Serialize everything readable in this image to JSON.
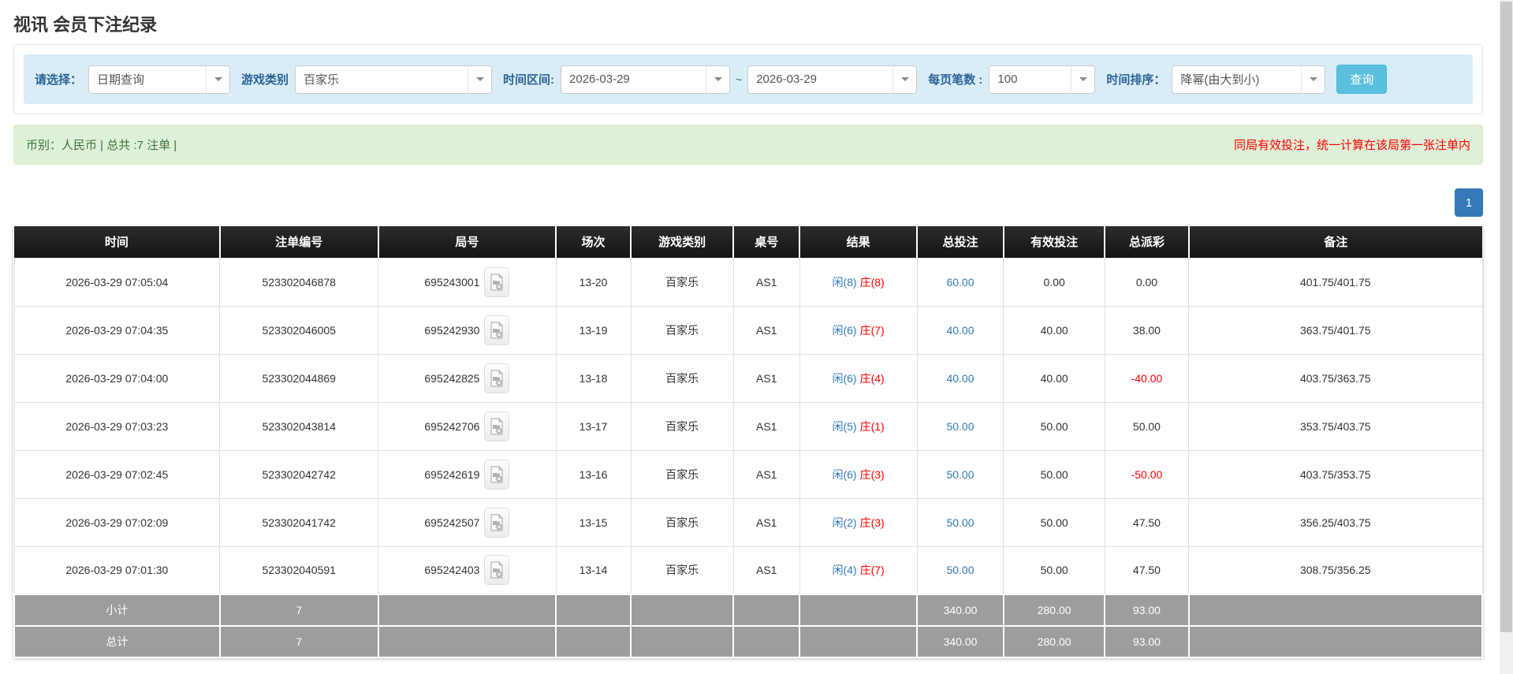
{
  "page": {
    "title": "视讯 会员下注纪录"
  },
  "colors": {
    "accent_blue": "#337ab7",
    "filter_bg": "#d9edf7",
    "summary_bg": "#dff0d8",
    "summary_text": "#3c763d",
    "alert_red": "#ff0000",
    "header_bg": "#1c1c1c",
    "total_row_bg": "#9d9d9d",
    "query_btn": "#5bc0de"
  },
  "filters": {
    "select_label": "请选择：",
    "select_value": "日期查询",
    "game_label": "游戏类别",
    "game_value": "百家乐",
    "range_label": "时间区间:",
    "date_from": "2026-03-29",
    "tilde": "~",
    "date_to": "2026-03-29",
    "per_page_label": "每页笔数 :",
    "per_page_value": "100",
    "sort_label": "时间排序：",
    "sort_value": "降幂(由大到小)",
    "query_button": "查询"
  },
  "summary": {
    "info": "币别：人民币 | 总共 :7 注单 |",
    "note": "同局有效投注，统一计算在该局第一张注单内"
  },
  "pagination": {
    "current": "1"
  },
  "table": {
    "headers": [
      "时间",
      "注单编号",
      "局号",
      "场次",
      "游戏类别",
      "桌号",
      "结果",
      "总投注",
      "有效投注",
      "总派彩",
      "备注"
    ],
    "rows": [
      {
        "time": "2026-03-29 07:05:04",
        "bet_id": "523302046878",
        "round_id": "695243001",
        "session": "13-20",
        "game": "百家乐",
        "table": "AS1",
        "player": "闲(8)",
        "banker": "庄(8)",
        "total_bet": "60.00",
        "valid_bet": "0.00",
        "payout": "0.00",
        "payout_neg": false,
        "note": "401.75/401.75"
      },
      {
        "time": "2026-03-29 07:04:35",
        "bet_id": "523302046005",
        "round_id": "695242930",
        "session": "13-19",
        "game": "百家乐",
        "table": "AS1",
        "player": "闲(6)",
        "banker": "庄(7)",
        "total_bet": "40.00",
        "valid_bet": "40.00",
        "payout": "38.00",
        "payout_neg": false,
        "note": "363.75/401.75"
      },
      {
        "time": "2026-03-29 07:04:00",
        "bet_id": "523302044869",
        "round_id": "695242825",
        "session": "13-18",
        "game": "百家乐",
        "table": "AS1",
        "player": "闲(6)",
        "banker": "庄(4)",
        "total_bet": "40.00",
        "valid_bet": "40.00",
        "payout": "-40.00",
        "payout_neg": true,
        "note": "403.75/363.75"
      },
      {
        "time": "2026-03-29 07:03:23",
        "bet_id": "523302043814",
        "round_id": "695242706",
        "session": "13-17",
        "game": "百家乐",
        "table": "AS1",
        "player": "闲(5)",
        "banker": "庄(1)",
        "total_bet": "50.00",
        "valid_bet": "50.00",
        "payout": "50.00",
        "payout_neg": false,
        "note": "353.75/403.75"
      },
      {
        "time": "2026-03-29 07:02:45",
        "bet_id": "523302042742",
        "round_id": "695242619",
        "session": "13-16",
        "game": "百家乐",
        "table": "AS1",
        "player": "闲(6)",
        "banker": "庄(3)",
        "total_bet": "50.00",
        "valid_bet": "50.00",
        "payout": "-50.00",
        "payout_neg": true,
        "note": "403.75/353.75"
      },
      {
        "time": "2026-03-29 07:02:09",
        "bet_id": "523302041742",
        "round_id": "695242507",
        "session": "13-15",
        "game": "百家乐",
        "table": "AS1",
        "player": "闲(2)",
        "banker": "庄(3)",
        "total_bet": "50.00",
        "valid_bet": "50.00",
        "payout": "47.50",
        "payout_neg": false,
        "note": "356.25/403.75"
      },
      {
        "time": "2026-03-29 07:01:30",
        "bet_id": "523302040591",
        "round_id": "695242403",
        "session": "13-14",
        "game": "百家乐",
        "table": "AS1",
        "player": "闲(4)",
        "banker": "庄(7)",
        "total_bet": "50.00",
        "valid_bet": "50.00",
        "payout": "47.50",
        "payout_neg": false,
        "note": "308.75/356.25"
      }
    ],
    "subtotal": {
      "label": "小计",
      "count": "7",
      "total_bet": "340.00",
      "valid_bet": "280.00",
      "payout": "93.00"
    },
    "total": {
      "label": "总计",
      "count": "7",
      "total_bet": "340.00",
      "valid_bet": "280.00",
      "payout": "93.00"
    }
  }
}
